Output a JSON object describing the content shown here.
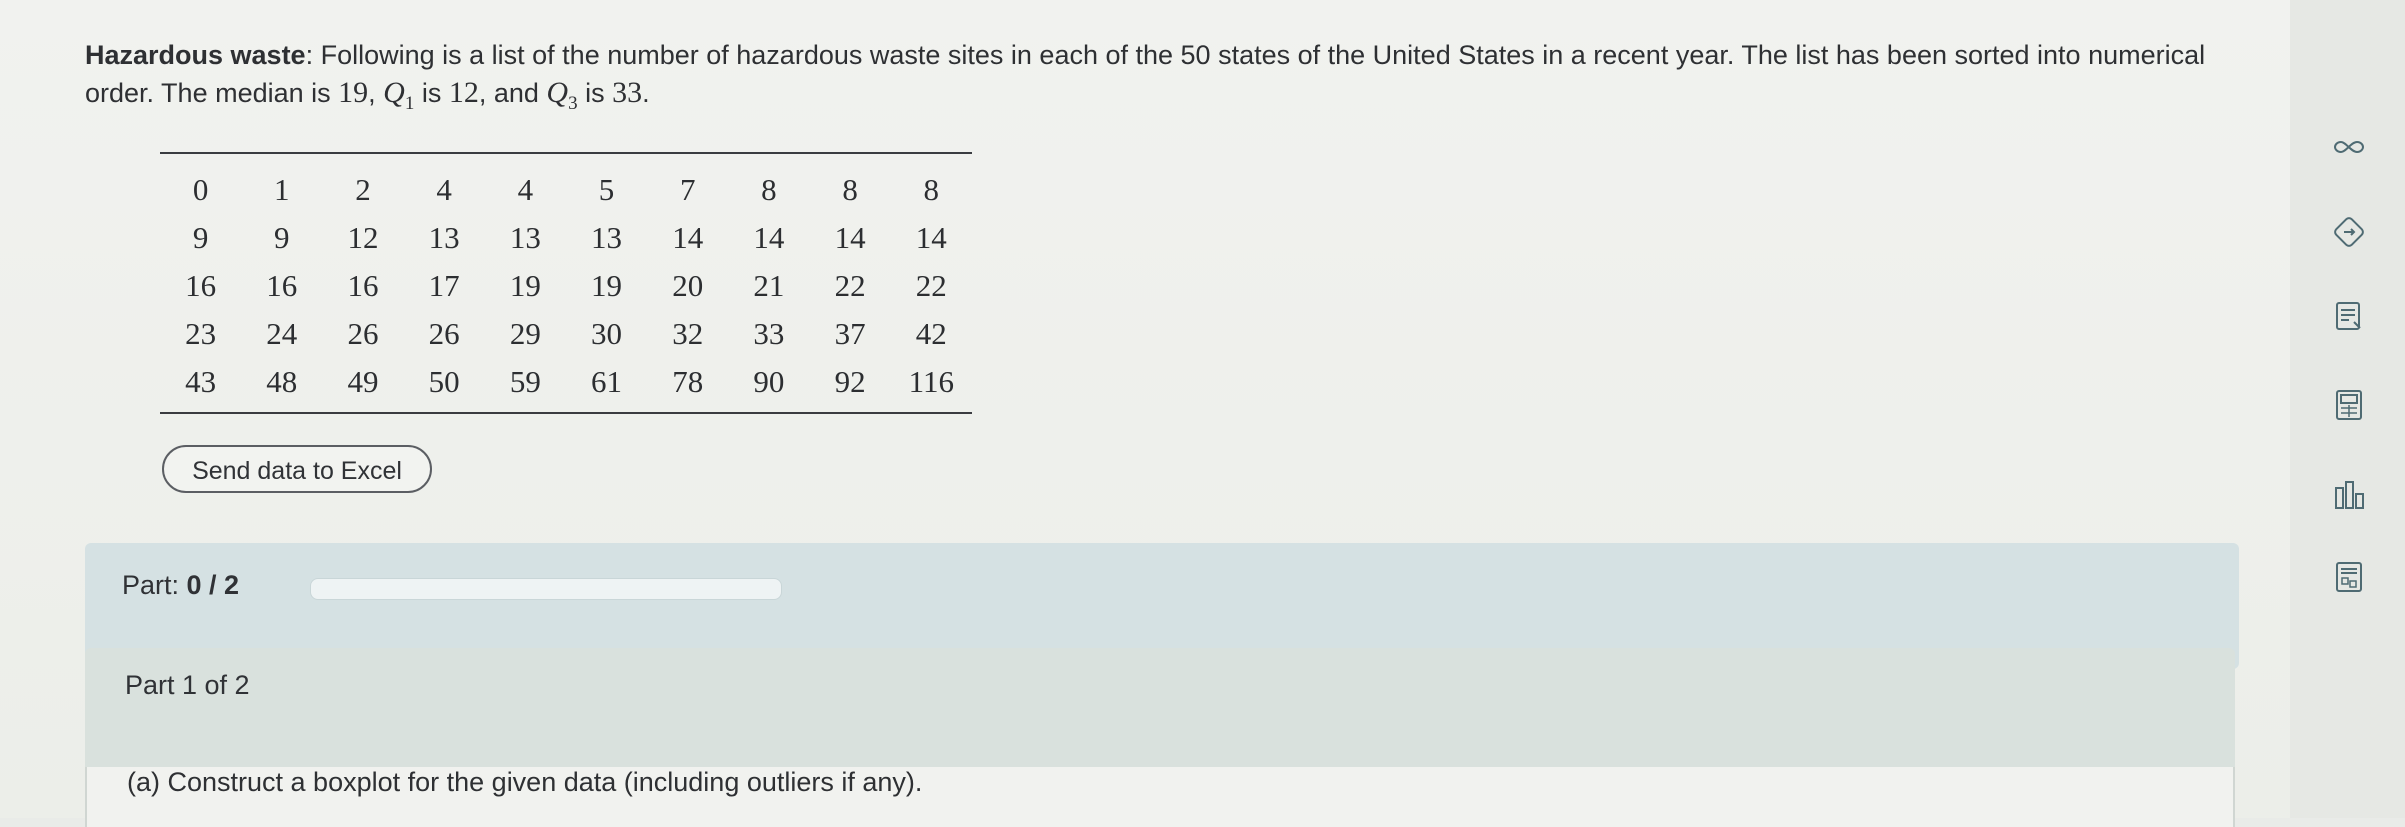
{
  "problem": {
    "heading": "Hazardous waste",
    "text_1": ": Following is a list of the number of hazardous waste sites in each of the 50 states of the United States in a recent year. The list has been sorted into numerical order. The median is ",
    "median": "19",
    "text_2": ", ",
    "q1_var": "Q",
    "q1_sub": "1",
    "text_3": " is ",
    "q1_value": "12",
    "text_4": ", and ",
    "q3_var": "Q",
    "q3_sub": "3",
    "text_5": " is ",
    "q3_value": "33",
    "text_6": "."
  },
  "table": {
    "rows": [
      [
        "0",
        "1",
        "2",
        "4",
        "4",
        "5",
        "7",
        "8",
        "8",
        "8"
      ],
      [
        "9",
        "9",
        "12",
        "13",
        "13",
        "13",
        "14",
        "14",
        "14",
        "14"
      ],
      [
        "16",
        "16",
        "16",
        "17",
        "19",
        "19",
        "20",
        "21",
        "22",
        "22"
      ],
      [
        "23",
        "24",
        "26",
        "26",
        "29",
        "30",
        "32",
        "33",
        "37",
        "42"
      ],
      [
        "43",
        "48",
        "49",
        "50",
        "59",
        "61",
        "78",
        "90",
        "92",
        "116"
      ]
    ]
  },
  "excel_button": "Send data to Excel",
  "part_progress": {
    "label": "Part: ",
    "value": "0 / 2",
    "fraction": 0
  },
  "part1": {
    "title": "Part 1 of 2",
    "question": "(a) Construct a boxplot for the given data (including outliers if any)."
  },
  "toolbar": {
    "icons": [
      "infinity-icon",
      "tag-icon",
      "notes-icon",
      "calculator-icon",
      "bar-chart-icon",
      "data-sheet-icon"
    ]
  }
}
